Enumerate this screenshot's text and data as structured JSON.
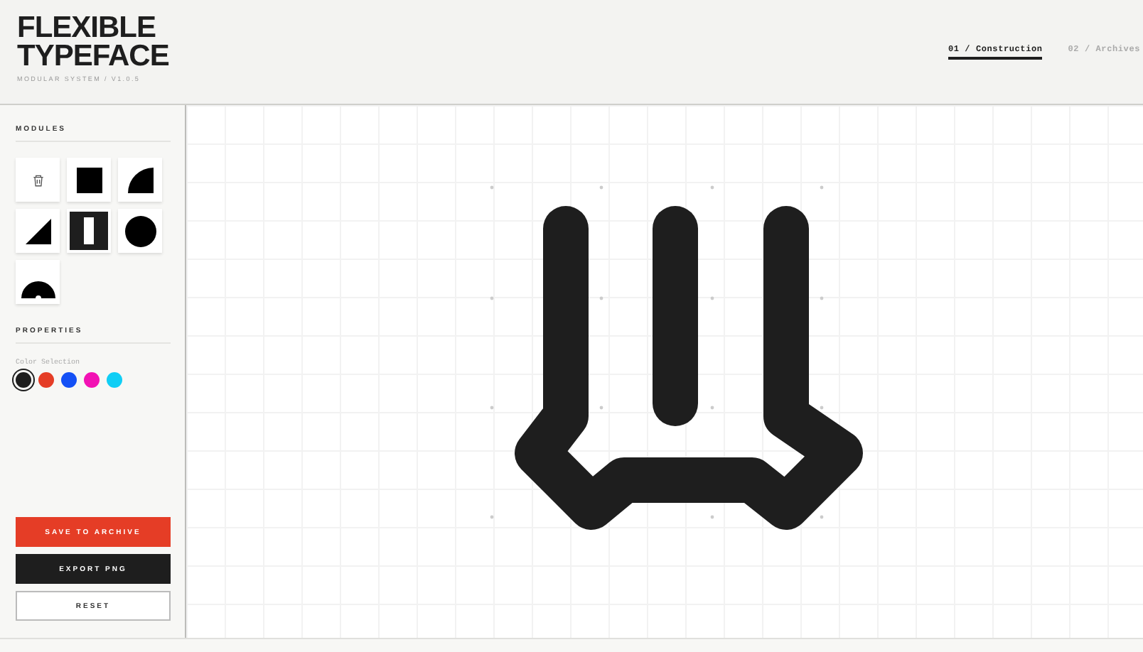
{
  "header": {
    "title_line_1": "FLEXIBLE",
    "title_line_2": "TYPEFACE",
    "subtitle": "MODULAR SYSTEM / V1.0.5"
  },
  "tabs": [
    {
      "label": "01 / Construction",
      "selected": true
    },
    {
      "label": "02 / Archives",
      "selected": false
    }
  ],
  "sidebar": {
    "modules_heading": "MODULES",
    "modules": [
      {
        "kind": "delete"
      },
      {
        "kind": "square"
      },
      {
        "kind": "quarter"
      },
      {
        "kind": "triangle"
      },
      {
        "kind": "slot"
      },
      {
        "kind": "circle"
      },
      {
        "kind": "arch"
      }
    ],
    "properties_heading": "PROPERTIES",
    "color_label": "Color Selection",
    "colors": [
      {
        "color": "#1e1e1e",
        "selected": true
      },
      {
        "color": "#e53d26",
        "selected": false
      },
      {
        "color": "#1450f5",
        "selected": false
      },
      {
        "color": "#f212b4",
        "selected": false
      },
      {
        "color": "#10cef5",
        "selected": false
      }
    ],
    "buttons": [
      {
        "label": "SAVE TO ARCHIVE",
        "kind": "primary"
      },
      {
        "label": "EXPORT PNG",
        "kind": "dark"
      },
      {
        "label": "RESET",
        "kind": "outline"
      }
    ]
  }
}
